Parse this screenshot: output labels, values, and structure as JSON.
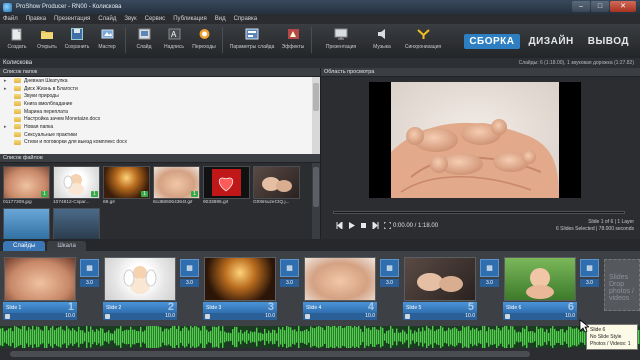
{
  "window": {
    "title": "ProShow Producer - RN00 - Колискова"
  },
  "menu": [
    "Файл",
    "Правка",
    "Презентация",
    "Слайд",
    "Звук",
    "Сервис",
    "Публикация",
    "Вид",
    "Справка"
  ],
  "toolbar": {
    "buttons": [
      {
        "label": "Создать",
        "icon": "new-project-icon"
      },
      {
        "label": "Открыть",
        "icon": "open-folder-icon"
      },
      {
        "label": "Сохранить",
        "icon": "save-disk-icon"
      },
      {
        "label": "Мастер",
        "icon": "wizard-icon"
      },
      {
        "label": "Слайд",
        "icon": "slide-icon"
      },
      {
        "label": "Надпись",
        "icon": "text-caption-icon"
      },
      {
        "label": "Переходы",
        "icon": "transitions-icon"
      },
      {
        "label": "Параметры слайда",
        "icon": "slide-options-icon"
      },
      {
        "label": "Эффекты",
        "icon": "effects-icon"
      },
      {
        "label": "Презентация",
        "icon": "presentation-icon"
      },
      {
        "label": "Музыка",
        "icon": "music-icon"
      },
      {
        "label": "Синхронизация",
        "icon": "sync-icon"
      }
    ],
    "modes": [
      "СБОРКА",
      "ДИЗАЙН",
      "ВЫВОД"
    ],
    "active_mode": "СБОРКА"
  },
  "project": {
    "title": "Колискова",
    "info": "Слайды: 6 (1:18.00), 1 звуковая дорожка (1:27.82)"
  },
  "folders": {
    "header": "Список папок",
    "items": [
      "Дневная Шкатулка",
      "Диск Жизнь в Благости",
      "Звуки природы",
      "Книга вмолбладание",
      "Марина переплата",
      "Настройка зачем Monetaize.docx",
      "Новая папка",
      "Сексуальные практики",
      "Стихи и поговорки для выезд комплекс docx"
    ]
  },
  "files": {
    "header": "Список файлов",
    "items": [
      {
        "name": "01177309.jpg",
        "used": "1"
      },
      {
        "name": "1074812-Clipar...",
        "used": "1"
      },
      {
        "name": "69.gif",
        "used": "1"
      },
      {
        "name": "8cd686064364f.gif",
        "used": "1"
      },
      {
        "name": "9033895.gif",
        "used": ""
      },
      {
        "name": "Gf0llrsuzeCtQ.j...",
        "used": ""
      },
      {
        "name": "",
        "used": ""
      },
      {
        "name": "",
        "used": ""
      }
    ]
  },
  "preview": {
    "header": "Область просмотра",
    "timecode": "0:00.00 / 1:18.00",
    "slide_line1": "Slide 1 of 6 | 1 Layer",
    "slide_line2": "6 Slides Selected | 78.000 seconds"
  },
  "timeline": {
    "tabs": [
      "Слайды",
      "Шкала"
    ],
    "active_tab": "Слайды",
    "slides": [
      {
        "name": "Slide 1",
        "num": "1",
        "duration": "10.0"
      },
      {
        "name": "Slide 2",
        "num": "2",
        "duration": "10.0"
      },
      {
        "name": "Slide 3",
        "num": "3",
        "duration": "10.0"
      },
      {
        "name": "Slide 4",
        "num": "4",
        "duration": "10.0"
      },
      {
        "name": "Slide 5",
        "num": "5",
        "duration": "10.0"
      },
      {
        "name": "Slide 6",
        "num": "6",
        "duration": "10.0"
      }
    ],
    "transition_durations": [
      "3.0",
      "3.0",
      "3.0",
      "3.0",
      "3.0",
      "3.0"
    ],
    "placeholder": "Slides Drop photos / videos"
  },
  "tooltip": {
    "line1": "Slide 6",
    "line2": "No Slide Style",
    "line3": "Photos / Videos: 1"
  },
  "colors": {
    "accent": "#2d7fc1",
    "slide_bar": "#3b82c8",
    "audio_wave": "#4fcf4a"
  }
}
